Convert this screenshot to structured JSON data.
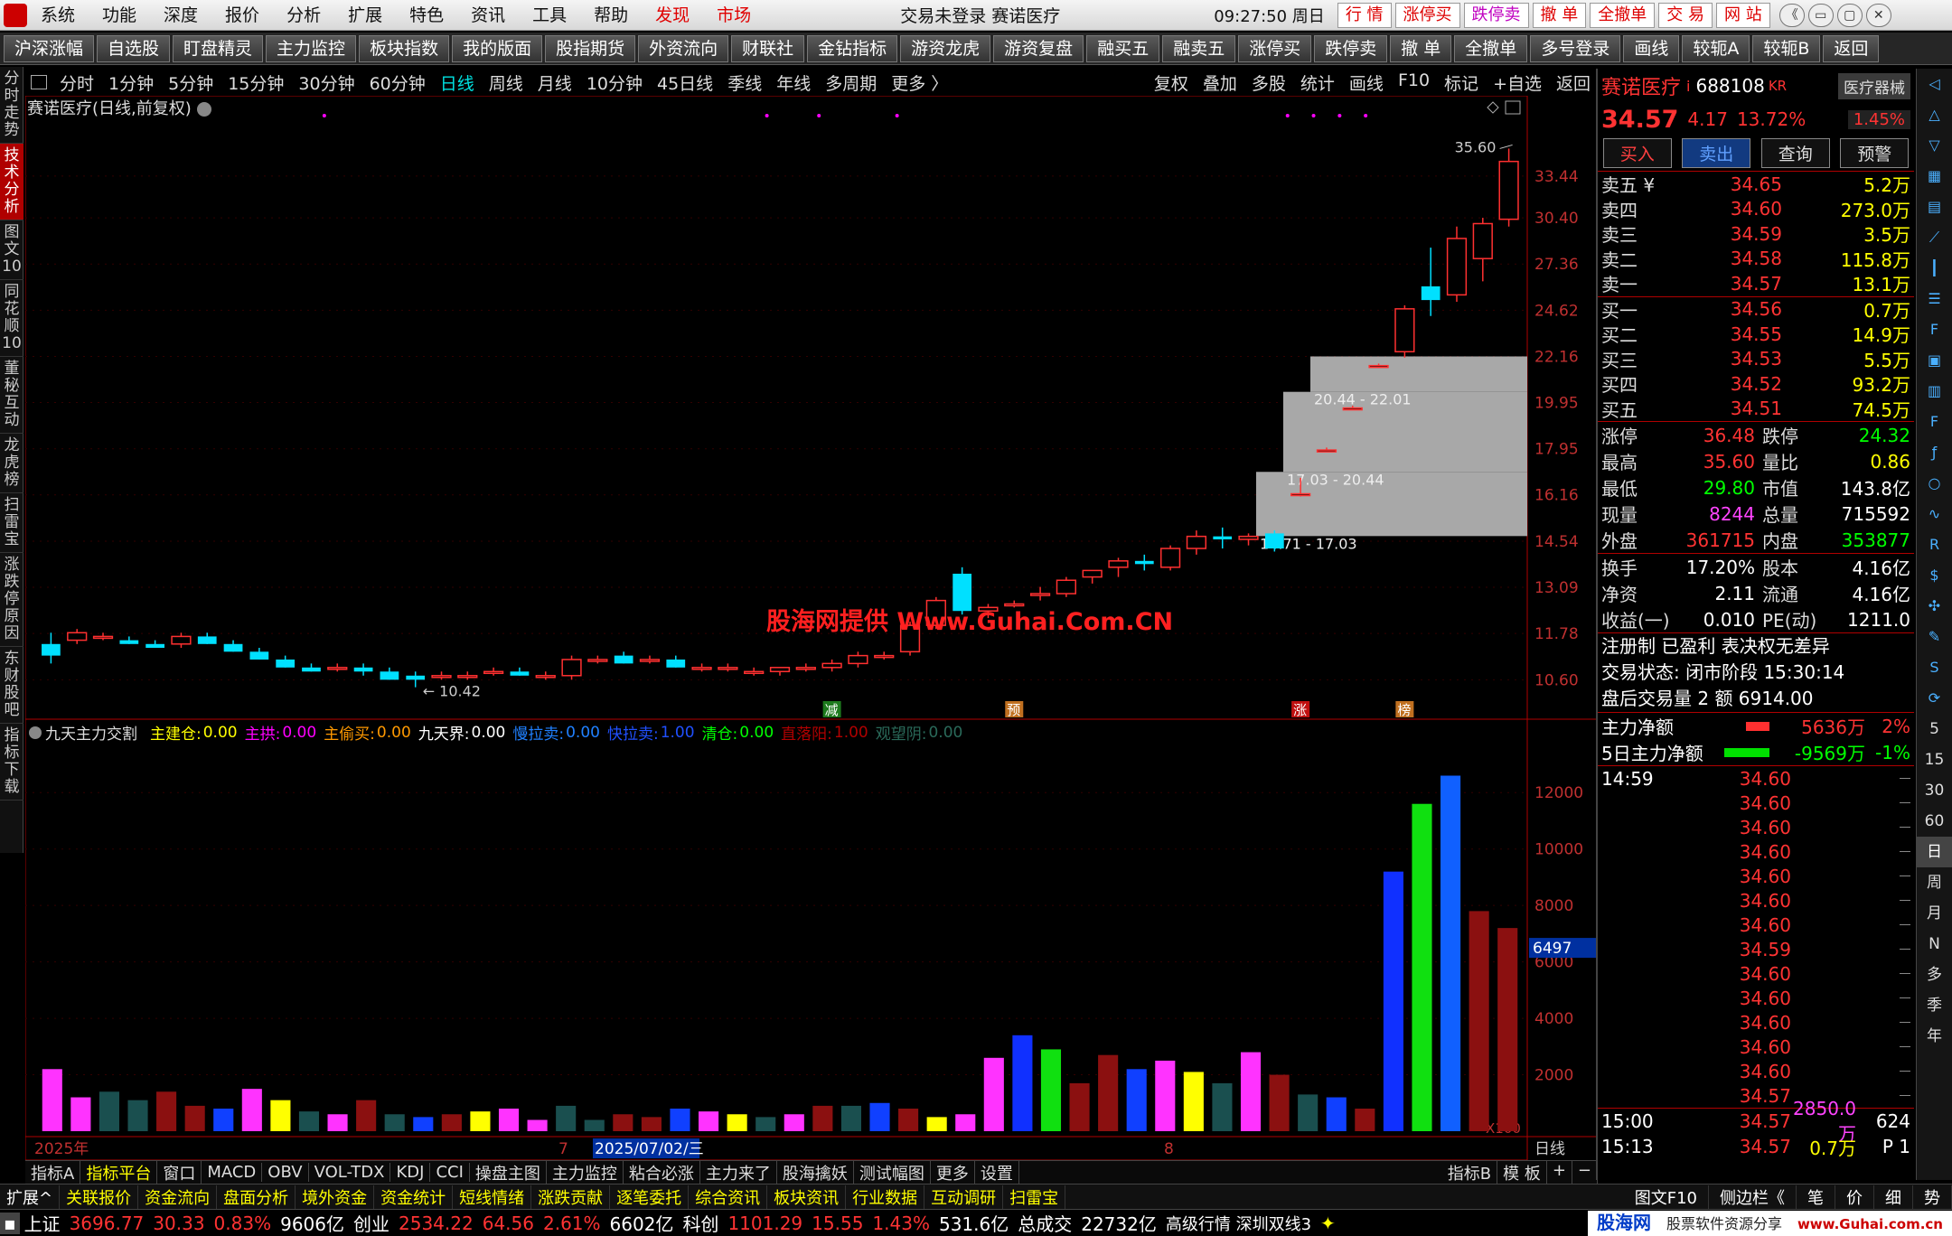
{
  "menubar": {
    "items": [
      "系统",
      "功能",
      "深度",
      "报价",
      "分析",
      "扩展",
      "特色",
      "资讯",
      "工具",
      "帮助"
    ],
    "highlight": [
      "发现",
      "市场"
    ],
    "title": "交易未登录 赛诺医疗",
    "clock": "09:27:50 周日",
    "right_buttons": [
      "行 情",
      "涨停买",
      "跌停卖",
      "撤 单",
      "全撤单",
      "交 易",
      "网 站"
    ],
    "window_controls": [
      "《",
      "▭",
      "▢",
      "✕"
    ]
  },
  "toolbar": {
    "buttons": [
      "沪深涨幅",
      "自选股",
      "盯盘精灵",
      "主力监控",
      "板块指数",
      "我的版面",
      "股指期货",
      "外资流向",
      "财联社",
      "金钻指标",
      "游资龙虎",
      "游资复盘",
      "融买五",
      "融卖五",
      "涨停买",
      "跌停卖",
      "撤 单",
      "全撤单",
      "多号登录",
      "画线",
      "较轭A",
      "较轭B",
      "返回"
    ]
  },
  "lefttabs": [
    "分时走势",
    "技术分析",
    "图文10",
    "同花顺10",
    "董秘互动",
    "龙虎榜",
    "扫雷宝",
    "涨跌停原因",
    "东财股吧",
    "指标下载"
  ],
  "periods": [
    "分时",
    "1分钟",
    "5分钟",
    "15分钟",
    "30分钟",
    "60分钟",
    "日线",
    "周线",
    "月线",
    "10分钟",
    "45日线",
    "季线",
    "年线",
    "多周期",
    "更多 〉"
  ],
  "period_active": "日线",
  "chart_tools": [
    "复权",
    "叠加",
    "多股",
    "统计",
    "画线",
    "F10",
    "标记",
    "+自选",
    "返回"
  ],
  "chart": {
    "title": "赛诺医疗(日线,前复权)",
    "price_axis": [
      "33.44",
      "30.40",
      "27.36",
      "24.62",
      "22.16",
      "19.95",
      "17.95",
      "16.16",
      "14.54",
      "13.09",
      "11.78",
      "10.60"
    ],
    "high_label": "35.60",
    "low_label": "10.42",
    "zones": [
      "20.44 - 22.01",
      "17.03 - 20.44",
      "14.71 - 17.03"
    ],
    "signals": [
      "减",
      "预",
      "涨",
      "榜"
    ],
    "watermark": "股海网提供 Www.Guhai.Com.CN"
  },
  "chart_data": {
    "type": "bar",
    "title": "",
    "candles": [
      {
        "o": 11.5,
        "h": 11.8,
        "l": 11.0,
        "c": 11.2
      },
      {
        "o": 11.6,
        "h": 11.9,
        "l": 11.5,
        "c": 11.8
      },
      {
        "o": 11.7,
        "h": 11.8,
        "l": 11.6,
        "c": 11.7
      },
      {
        "o": 11.6,
        "h": 11.7,
        "l": 11.5,
        "c": 11.5
      },
      {
        "o": 11.5,
        "h": 11.6,
        "l": 11.4,
        "c": 11.4
      },
      {
        "o": 11.5,
        "h": 11.8,
        "l": 11.4,
        "c": 11.7
      },
      {
        "o": 11.7,
        "h": 11.8,
        "l": 11.5,
        "c": 11.5
      },
      {
        "o": 11.5,
        "h": 11.6,
        "l": 11.3,
        "c": 11.3
      },
      {
        "o": 11.3,
        "h": 11.4,
        "l": 11.1,
        "c": 11.1
      },
      {
        "o": 11.1,
        "h": 11.2,
        "l": 10.9,
        "c": 10.9
      },
      {
        "o": 10.9,
        "h": 11.0,
        "l": 10.8,
        "c": 10.8
      },
      {
        "o": 10.9,
        "h": 11.0,
        "l": 10.8,
        "c": 10.9
      },
      {
        "o": 10.9,
        "h": 11.0,
        "l": 10.7,
        "c": 10.8
      },
      {
        "o": 10.8,
        "h": 10.9,
        "l": 10.6,
        "c": 10.6
      },
      {
        "o": 10.7,
        "h": 10.8,
        "l": 10.42,
        "c": 10.6
      },
      {
        "o": 10.7,
        "h": 10.8,
        "l": 10.6,
        "c": 10.7
      },
      {
        "o": 10.7,
        "h": 10.8,
        "l": 10.6,
        "c": 10.7
      },
      {
        "o": 10.8,
        "h": 10.9,
        "l": 10.7,
        "c": 10.8
      },
      {
        "o": 10.8,
        "h": 10.9,
        "l": 10.7,
        "c": 10.7
      },
      {
        "o": 10.7,
        "h": 10.8,
        "l": 10.6,
        "c": 10.7
      },
      {
        "o": 10.7,
        "h": 11.2,
        "l": 10.6,
        "c": 11.1
      },
      {
        "o": 11.1,
        "h": 11.2,
        "l": 11.0,
        "c": 11.1
      },
      {
        "o": 11.2,
        "h": 11.3,
        "l": 11.0,
        "c": 11.0
      },
      {
        "o": 11.1,
        "h": 11.2,
        "l": 11.0,
        "c": 11.1
      },
      {
        "o": 11.1,
        "h": 11.2,
        "l": 10.9,
        "c": 10.9
      },
      {
        "o": 10.9,
        "h": 11.0,
        "l": 10.8,
        "c": 10.9
      },
      {
        "o": 10.9,
        "h": 11.0,
        "l": 10.8,
        "c": 10.9
      },
      {
        "o": 10.8,
        "h": 10.9,
        "l": 10.7,
        "c": 10.8
      },
      {
        "o": 10.8,
        "h": 10.9,
        "l": 10.7,
        "c": 10.9
      },
      {
        "o": 10.9,
        "h": 11.0,
        "l": 10.8,
        "c": 10.9
      },
      {
        "o": 10.9,
        "h": 11.1,
        "l": 10.8,
        "c": 11.0
      },
      {
        "o": 11.0,
        "h": 11.3,
        "l": 10.9,
        "c": 11.2
      },
      {
        "o": 11.2,
        "h": 11.3,
        "l": 11.1,
        "c": 11.2
      },
      {
        "o": 11.3,
        "h": 12.1,
        "l": 11.2,
        "c": 12.0
      },
      {
        "o": 12.0,
        "h": 12.8,
        "l": 11.9,
        "c": 12.7
      },
      {
        "o": 13.5,
        "h": 13.7,
        "l": 12.3,
        "c": 12.4
      },
      {
        "o": 12.4,
        "h": 12.6,
        "l": 12.2,
        "c": 12.5
      },
      {
        "o": 12.6,
        "h": 12.7,
        "l": 12.5,
        "c": 12.6
      },
      {
        "o": 12.9,
        "h": 13.1,
        "l": 12.7,
        "c": 12.9
      },
      {
        "o": 12.9,
        "h": 13.4,
        "l": 12.8,
        "c": 13.3
      },
      {
        "o": 13.4,
        "h": 13.6,
        "l": 13.2,
        "c": 13.6
      },
      {
        "o": 13.7,
        "h": 14.0,
        "l": 13.4,
        "c": 13.9
      },
      {
        "o": 13.9,
        "h": 14.1,
        "l": 13.6,
        "c": 13.8
      },
      {
        "o": 13.7,
        "h": 14.4,
        "l": 13.6,
        "c": 14.3
      },
      {
        "o": 14.3,
        "h": 14.9,
        "l": 14.1,
        "c": 14.7
      },
      {
        "o": 14.7,
        "h": 15.0,
        "l": 14.3,
        "c": 14.6
      },
      {
        "o": 14.6,
        "h": 14.8,
        "l": 14.4,
        "c": 14.7
      },
      {
        "o": 14.8,
        "h": 14.9,
        "l": 14.2,
        "c": 14.3
      },
      {
        "o": 16.2,
        "h": 16.8,
        "l": 16.1,
        "c": 16.2
      },
      {
        "o": 17.9,
        "h": 18.0,
        "l": 17.9,
        "c": 17.9
      },
      {
        "o": 19.7,
        "h": 19.8,
        "l": 19.7,
        "c": 19.7
      },
      {
        "o": 21.7,
        "h": 21.8,
        "l": 21.6,
        "c": 21.7
      },
      {
        "o": 22.4,
        "h": 24.9,
        "l": 22.1,
        "c": 24.7
      },
      {
        "o": 26.0,
        "h": 28.4,
        "l": 24.3,
        "c": 25.2
      },
      {
        "o": 25.5,
        "h": 29.8,
        "l": 25.1,
        "c": 29.0
      },
      {
        "o": 27.7,
        "h": 30.4,
        "l": 26.3,
        "c": 30.0
      },
      {
        "o": 30.3,
        "h": 35.6,
        "l": 29.8,
        "c": 34.57
      }
    ],
    "volume_axis": [
      "12000",
      "10000",
      "8000",
      "6000",
      "4000",
      "2000"
    ],
    "volume_current": "6497",
    "volume_unit": "X100",
    "volumes": [
      2200,
      1200,
      1400,
      1100,
      1400,
      900,
      800,
      1500,
      1100,
      700,
      600,
      1100,
      600,
      500,
      600,
      700,
      800,
      400,
      900,
      400,
      600,
      500,
      800,
      700,
      600,
      500,
      600,
      900,
      900,
      1000,
      800,
      500,
      600,
      2600,
      3400,
      2900,
      1700,
      2700,
      2200,
      2500,
      2100,
      1700,
      2800,
      2000,
      1300,
      1200,
      800,
      9200,
      11600,
      12600,
      7800,
      7200
    ],
    "x_labels": [
      "2025年",
      "7",
      "2025/07/02/三",
      "8"
    ],
    "period_label": "日线"
  },
  "indicator": {
    "name": "九天主力交割",
    "items": [
      {
        "label": "主建仓:",
        "value": "0.00",
        "color": "#ffff00"
      },
      {
        "label": "主拱:",
        "value": "0.00",
        "color": "#ff00ff"
      },
      {
        "label": "主偷买:",
        "value": "0.00",
        "color": "#ff9900"
      },
      {
        "label": "九天界:",
        "value": "0.00",
        "color": "#ffffff"
      },
      {
        "label": "慢拉卖:",
        "value": "0.00",
        "color": "#2080ff"
      },
      {
        "label": "快拉卖:",
        "value": "1.00",
        "color": "#2050ff"
      },
      {
        "label": "清仓:",
        "value": "0.00",
        "color": "#00ff00"
      },
      {
        "label": "直落阳:",
        "value": "1.00",
        "color": "#b00000"
      },
      {
        "label": "观望阴:",
        "value": "0.00",
        "color": "#2a6a5a"
      }
    ]
  },
  "quote": {
    "name": "赛诺医疗",
    "code": "688108",
    "tag": "KR",
    "industry": "医疗器械",
    "price": "34.57",
    "change": "4.17",
    "pct": "13.72%",
    "industry_pct": "1.45%",
    "buttons": [
      "买入",
      "卖出",
      "查询",
      "预警"
    ],
    "asks": [
      [
        "卖五 ¥",
        "34.65",
        "5.2万"
      ],
      [
        "卖四",
        "34.60",
        "273.0万"
      ],
      [
        "卖三",
        "34.59",
        "3.5万"
      ],
      [
        "卖二",
        "34.58",
        "115.8万"
      ],
      [
        "卖一",
        "34.57",
        "13.1万"
      ]
    ],
    "bids": [
      [
        "买一",
        "34.56",
        "0.7万"
      ],
      [
        "买二",
        "34.55",
        "14.9万"
      ],
      [
        "买三",
        "34.53",
        "5.5万"
      ],
      [
        "买四",
        "34.52",
        "93.2万"
      ],
      [
        "买五",
        "34.51",
        "74.5万"
      ]
    ],
    "stats": [
      [
        "涨停",
        "36.48",
        "跌停",
        "24.32"
      ],
      [
        "最高",
        "35.60",
        "量比",
        "0.86"
      ],
      [
        "最低",
        "29.80",
        "市值",
        "143.8亿"
      ],
      [
        "现量",
        "8244",
        "总量",
        "715592"
      ],
      [
        "外盘",
        "361715",
        "内盘",
        "353877"
      ]
    ],
    "stats2": [
      [
        "换手",
        "17.20%",
        "股本",
        "4.16亿"
      ],
      [
        "净资",
        "2.11",
        "流通",
        "4.16亿"
      ],
      [
        "收益(一)",
        "0.010",
        "PE(动)",
        "1211.0"
      ]
    ],
    "notes": [
      "注册制 已盈利 表决权无差异",
      "交易状态: 闭市阶段 15:30:14",
      "盘后交易量 2 额 6914.00"
    ],
    "flow": [
      [
        "主力净额",
        "5636万",
        "2%"
      ],
      [
        "5日主力净额",
        "-9569万",
        "-1%"
      ]
    ],
    "ticks": [
      [
        "14:59",
        "34.60"
      ],
      [
        "",
        "34.60"
      ],
      [
        "",
        "34.60"
      ],
      [
        "",
        "34.60"
      ],
      [
        "",
        "34.60"
      ],
      [
        "",
        "34.60"
      ],
      [
        "",
        "34.60"
      ],
      [
        "",
        "34.59"
      ],
      [
        "",
        "34.60"
      ],
      [
        "",
        "34.60"
      ],
      [
        "",
        "34.60"
      ],
      [
        "",
        "34.60"
      ],
      [
        "",
        "34.60"
      ],
      [
        "",
        "34.57"
      ]
    ],
    "tick_tail": [
      [
        "15:00",
        "34.57",
        "2850.0万",
        "624"
      ],
      [
        "15:13",
        "34.57",
        "0.7万",
        "P 1"
      ]
    ]
  },
  "rightstrip": [
    "5",
    "15",
    "30",
    "60",
    "日",
    "周",
    "月",
    "N",
    "多",
    "季",
    "年"
  ],
  "bottomtabs": [
    "指标A",
    "指标平台",
    "窗口",
    "MACD",
    "OBV",
    "VOL-TDX",
    "KDJ",
    "CCI",
    "操盘主图",
    "主力监控",
    "粘合必涨",
    "主力来了",
    "股海擒妖",
    "测试幅图",
    "更多",
    "设置"
  ],
  "bottomtabs_right": [
    "指标B",
    "模 板",
    "+",
    "−"
  ],
  "statusbar1": [
    "扩展^",
    "关联报价",
    "资金流向",
    "盘面分析",
    "境外资金",
    "资金统计",
    "短线情绪",
    "涨跌贡献",
    "逐笔委托",
    "综合资讯",
    "板块资讯",
    "行业数据",
    "互动调研",
    "扫雷宝"
  ],
  "statusbar1_right": [
    "图文F10",
    "侧边栏《",
    "笔",
    "价",
    "细",
    "势"
  ],
  "statusbar2": {
    "sh_label": "上证",
    "sh_val": "3696.77",
    "sh_chg": "30.33",
    "sh_pct": "0.83%",
    "sh_amt": "9606亿",
    "cy_label": "创业",
    "cy_val": "2534.22",
    "cy_chg": "64.56",
    "cy_pct": "2.61%",
    "cy_amt": "6602亿",
    "kc_label": "科创",
    "kc_val": "1101.29",
    "kc_chg": "15.55",
    "kc_pct": "1.43%",
    "kc_amt": "531.6亿",
    "total_label": "总成交",
    "total_val": "22732亿",
    "mode": "高级行情 深圳双线3",
    "brand": "股海网",
    "brand_sub": "股票软件资源分享",
    "url": "www.Guhai.com.cn"
  }
}
